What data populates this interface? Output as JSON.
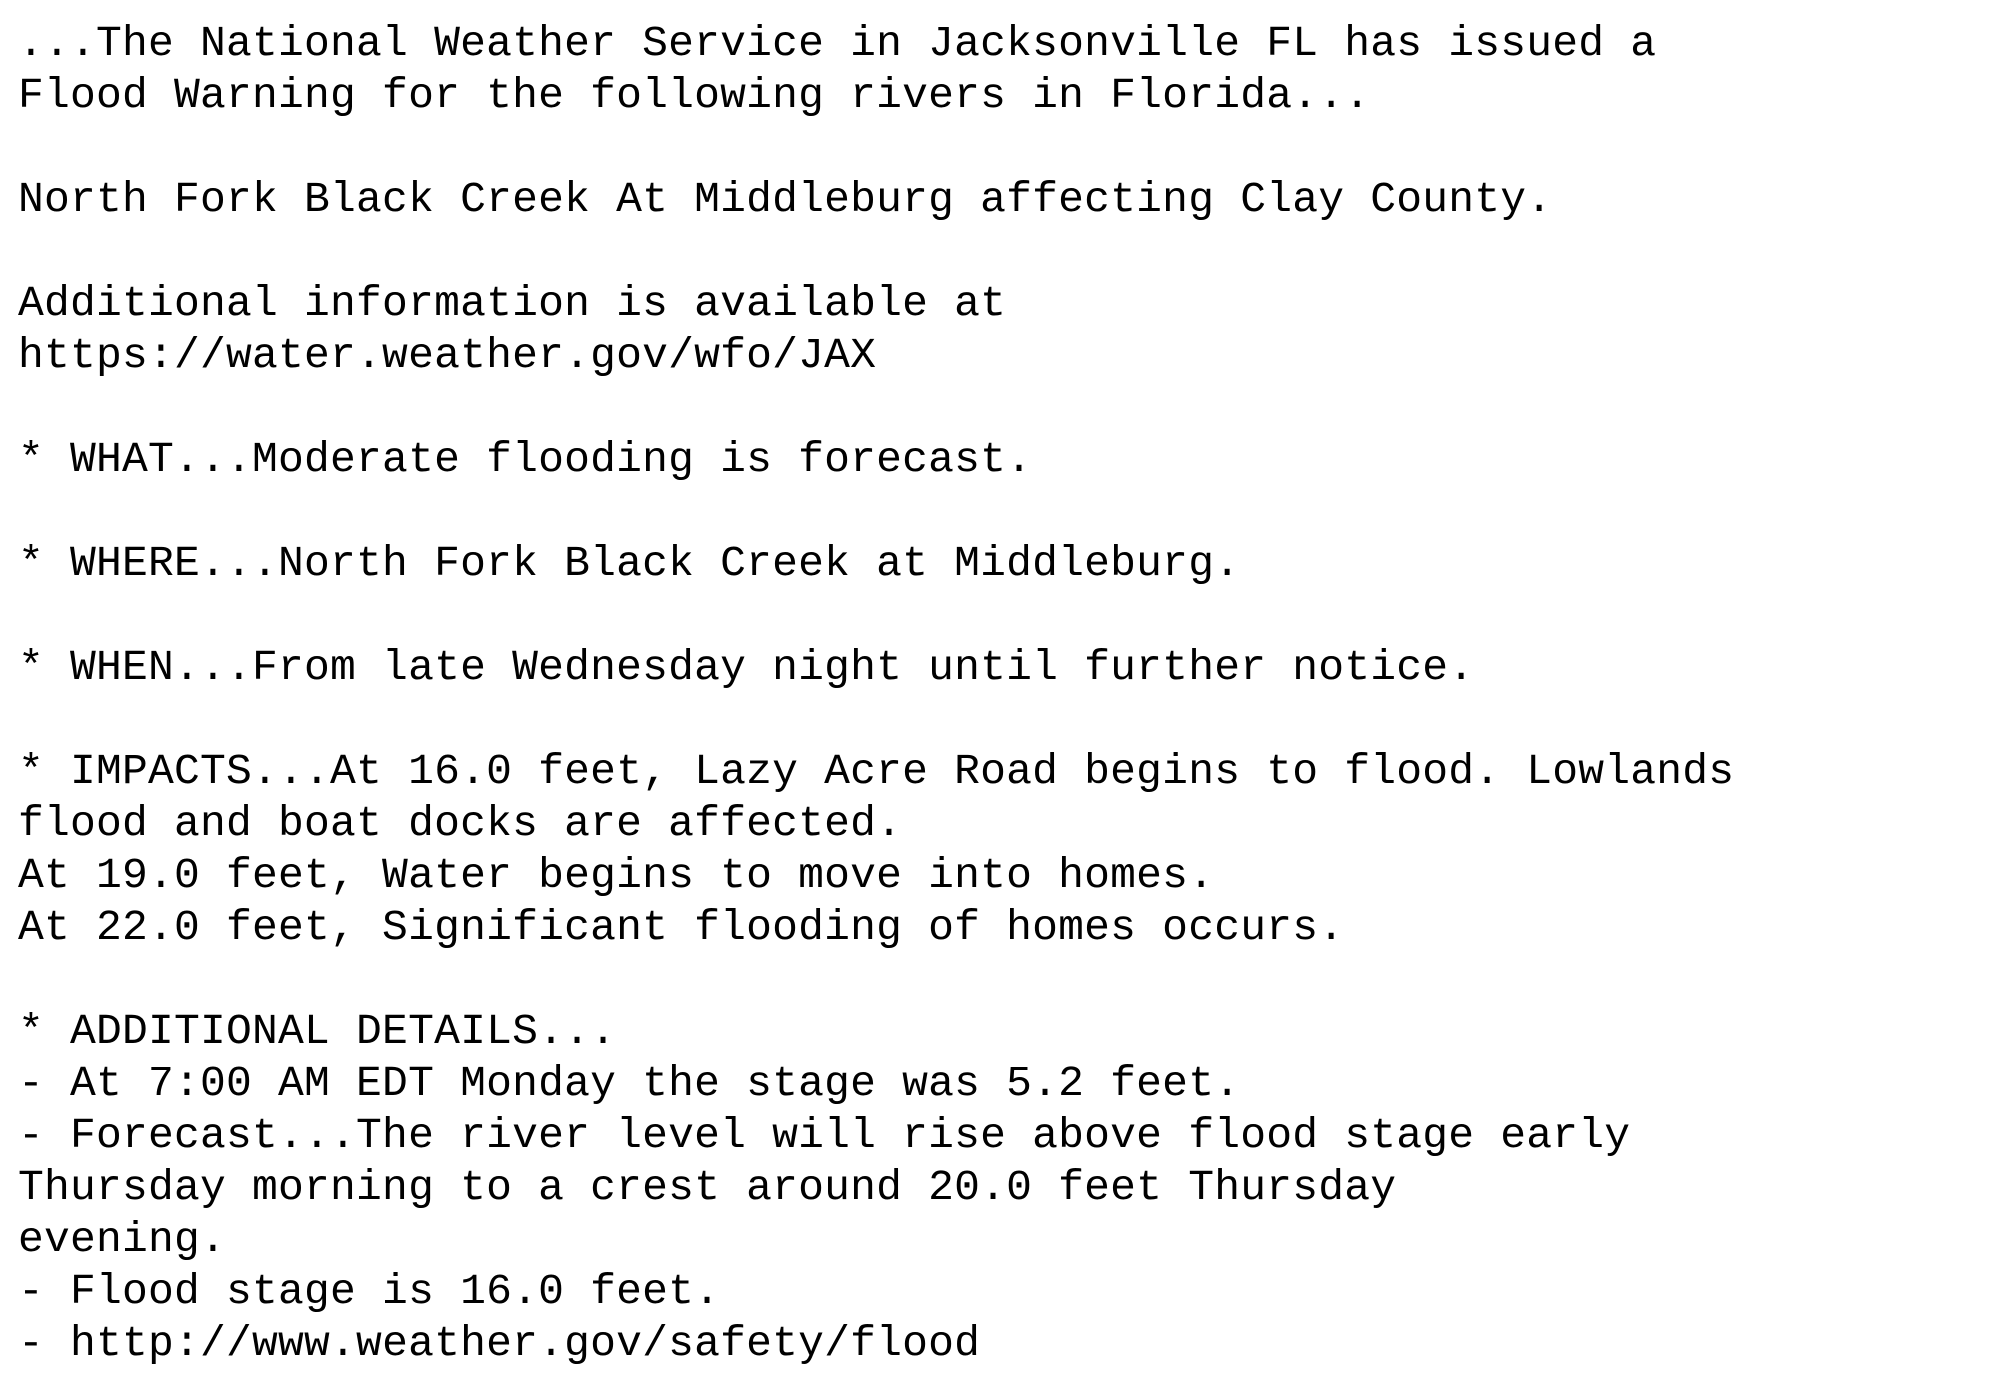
{
  "document": {
    "headline": [
      "...The National Weather Service in Jacksonville FL has issued a",
      "Flood Warning for the following rivers in Florida..."
    ],
    "affected": "North Fork Black Creek At Middleburg affecting Clay County.",
    "additional_info": "Additional information is available at",
    "info_url": "https://water.weather.gov/wfo/JAX",
    "what": "* WHAT...Moderate flooding is forecast.",
    "where": "* WHERE...North Fork Black Creek at Middleburg.",
    "when": "* WHEN...From late Wednesday night until further notice.",
    "impacts": [
      "* IMPACTS...At 16.0 feet, Lazy Acre Road begins to flood. Lowlands",
      "flood and boat docks are affected.",
      "At 19.0 feet, Water begins to move into homes.",
      "At 22.0 feet, Significant flooding of homes occurs."
    ],
    "details_header": "* ADDITIONAL DETAILS...",
    "details": [
      "- At 7:00 AM EDT Monday the stage was 5.2 feet.",
      "- Forecast...The river level will rise above flood stage early",
      "Thursday morning to a crest around 20.0 feet Thursday",
      "evening.",
      "- Flood stage is 16.0 feet."
    ],
    "safety_prefix": "- ",
    "safety_url": "http://www.weather.gov/safety/flood"
  }
}
